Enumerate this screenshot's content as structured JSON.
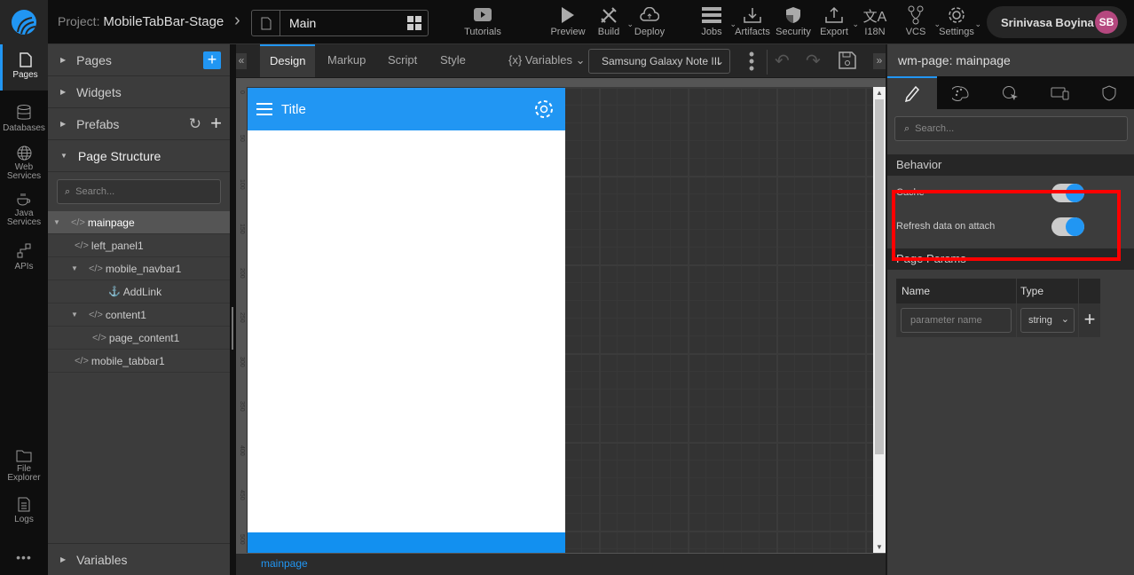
{
  "topbar": {
    "project_label": "Project:",
    "project_name": "MobileTabBar-Stage",
    "current_page": "Main",
    "tools": [
      {
        "label": "Tutorials",
        "icon": "youtube-icon"
      },
      {
        "label": "Preview",
        "icon": "play-icon"
      },
      {
        "label": "Build",
        "icon": "build-tools-icon"
      },
      {
        "label": "Deploy",
        "icon": "cloud-upload-icon"
      },
      {
        "label": "Jobs",
        "icon": "server-icon"
      },
      {
        "label": "Artifacts",
        "icon": "download-icon"
      },
      {
        "label": "Security",
        "icon": "shield-icon"
      },
      {
        "label": "Export",
        "icon": "upload-icon"
      },
      {
        "label": "I18N",
        "icon": "translate-icon"
      },
      {
        "label": "VCS",
        "icon": "git-branch-icon"
      },
      {
        "label": "Settings",
        "icon": "gear-icon"
      }
    ],
    "user_name": "Srinivasa Boyina",
    "user_initials": "SB"
  },
  "leftnav": {
    "items": [
      {
        "label": "Pages",
        "icon": "page-icon"
      },
      {
        "label": "Databases",
        "icon": "database-icon"
      },
      {
        "label": "Web Services",
        "icon": "globe-icon"
      },
      {
        "label": "Java Services",
        "icon": "coffee-icon"
      },
      {
        "label": "APIs",
        "icon": "api-icon"
      },
      {
        "label": "File Explorer",
        "icon": "folder-icon"
      },
      {
        "label": "Logs",
        "icon": "logs-icon"
      }
    ],
    "more": "•••"
  },
  "panel": {
    "sections": {
      "pages": "Pages",
      "widgets": "Widgets",
      "prefabs": "Prefabs",
      "page_structure": "Page Structure",
      "variables": "Variables"
    },
    "search_placeholder": "Search...",
    "tree": [
      {
        "label": "mainpage",
        "type": "tag"
      },
      {
        "label": "left_panel1",
        "type": "tag"
      },
      {
        "label": "mobile_navbar1",
        "type": "tag"
      },
      {
        "label": "AddLink",
        "type": "anchor"
      },
      {
        "label": "content1",
        "type": "tag"
      },
      {
        "label": "page_content1",
        "type": "tag"
      },
      {
        "label": "mobile_tabbar1",
        "type": "tag"
      }
    ]
  },
  "editor": {
    "tabs": [
      "Design",
      "Markup",
      "Script",
      "Style"
    ],
    "active_tab": "Design",
    "variables_label": "{x} Variables",
    "device": "Samsung Galaxy Note III",
    "ruler_ticks": [
      "0",
      "50",
      "100",
      "150",
      "200",
      "250",
      "300",
      "350",
      "400",
      "450",
      "500"
    ],
    "navbar_title": "Title",
    "status_path": "mainpage"
  },
  "props": {
    "title": "wm-page: mainpage",
    "search_placeholder": "Search...",
    "behavior_label": "Behavior",
    "cache_label": "Cache",
    "cache_on": true,
    "refresh_label": "Refresh data on attach",
    "refresh_on": true,
    "page_params_label": "Page Params",
    "col_name": "Name",
    "col_type": "Type",
    "param_placeholder": "parameter name",
    "param_type": "string",
    "accent_color": "#2196f3",
    "highlight_color": "#ff0000"
  }
}
